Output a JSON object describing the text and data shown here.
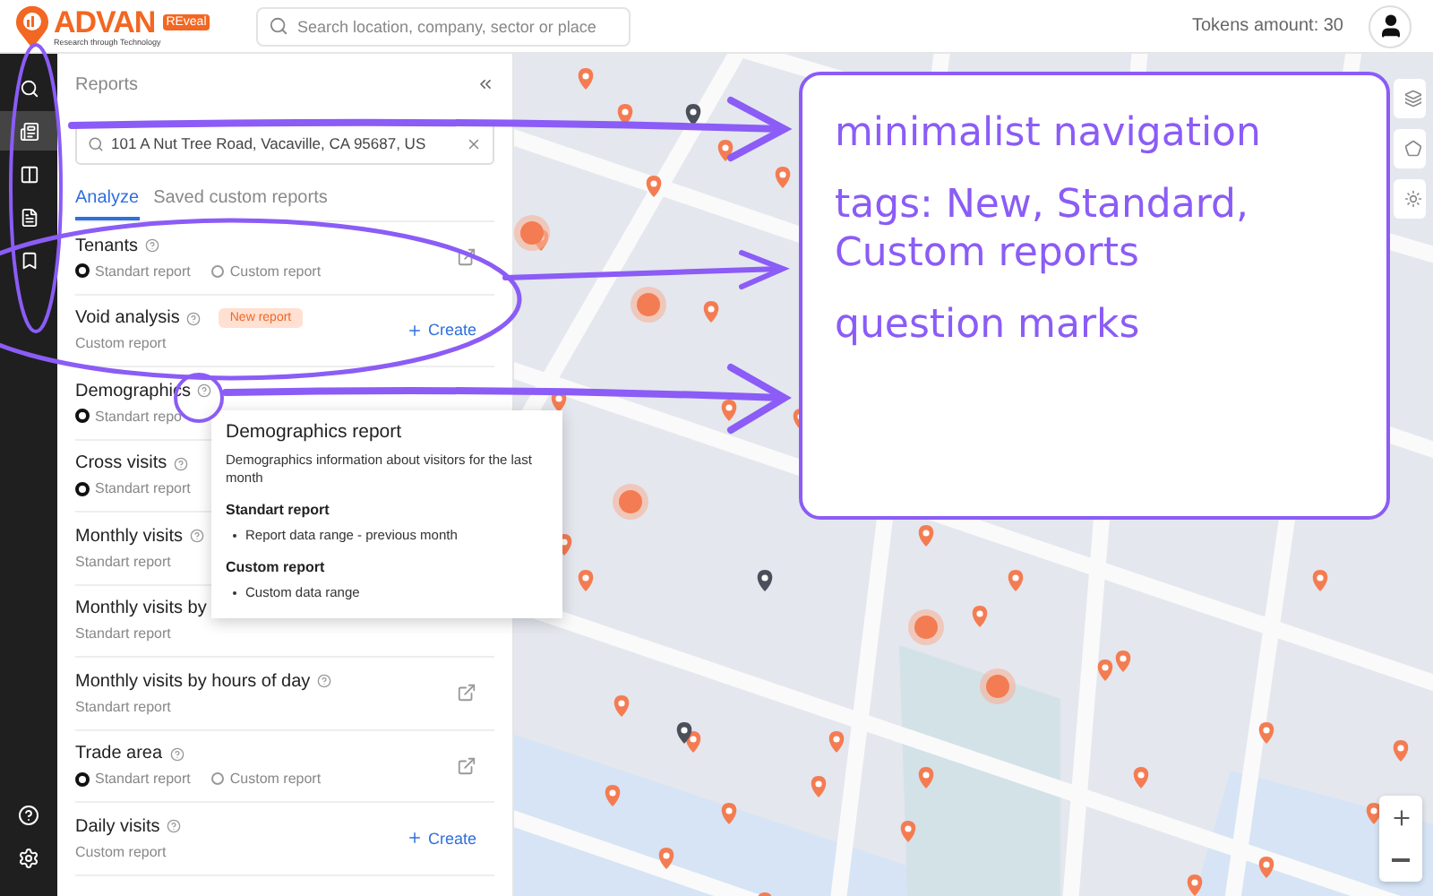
{
  "header": {
    "logo": {
      "name": "ADVAN",
      "badge": "REveal",
      "tagline": "Research through Technology"
    },
    "search": {
      "placeholder": "Search location, company, sector or place"
    },
    "tokens": "Tokens amount: 30"
  },
  "nav": [
    {
      "kind": "search",
      "selected": false
    },
    {
      "kind": "report",
      "selected": true
    },
    {
      "kind": "compare",
      "selected": false
    },
    {
      "kind": "document",
      "selected": false
    },
    {
      "kind": "bookmark",
      "selected": false
    }
  ],
  "nav_bottom": [
    {
      "kind": "help"
    },
    {
      "kind": "settings"
    }
  ],
  "panel": {
    "title": "Reports",
    "address": "101 A Nut Tree Road, Vacaville, CA 95687, US",
    "tabs": [
      {
        "label": "Analyze",
        "selected": true
      },
      {
        "label": "Saved custom reports",
        "selected": false
      }
    ],
    "reports": [
      {
        "name": "Tenants",
        "help": true,
        "options": [
          {
            "label": "Standart report",
            "selected": true
          },
          {
            "label": "Custom report",
            "selected": false
          }
        ],
        "action": {
          "kind": "open"
        }
      },
      {
        "name": "Void analysis",
        "help": true,
        "tag": "New report",
        "subtitle": "Custom report",
        "action": {
          "kind": "create",
          "label": "Create"
        }
      },
      {
        "name": "Demographics",
        "help": true,
        "options": [
          {
            "label": "Standart repo",
            "selected": true
          }
        ]
      },
      {
        "name": "Cross visits",
        "help": true,
        "options": [
          {
            "label": "Standart report",
            "selected": true
          }
        ]
      },
      {
        "name": "Monthly visits",
        "help": true,
        "subtitle": "Standart report"
      },
      {
        "name": "Monthly visits by",
        "help": false,
        "subtitle": "Standart report"
      },
      {
        "name": "Monthly visits by hours of day",
        "help": true,
        "subtitle": "Standart report",
        "action": {
          "kind": "open"
        }
      },
      {
        "name": "Trade area",
        "help": true,
        "options": [
          {
            "label": "Standart report",
            "selected": true
          },
          {
            "label": "Custom report",
            "selected": false
          }
        ],
        "action": {
          "kind": "open"
        }
      },
      {
        "name": "Daily visits",
        "help": true,
        "subtitle": "Custom report",
        "action": {
          "kind": "create",
          "label": "Create"
        }
      }
    ]
  },
  "tooltip": {
    "title": "Demographics report",
    "text": "Demographics information about visitors for the last month",
    "sections": [
      {
        "heading": "Standart report",
        "items": [
          "Report data range - previous month"
        ]
      },
      {
        "heading": "Custom report",
        "items": [
          "Custom data range"
        ]
      }
    ]
  },
  "annotation": {
    "lines": [
      "minimalist navigation",
      "tags: New, Standard, Custom reports",
      "question marks"
    ]
  }
}
